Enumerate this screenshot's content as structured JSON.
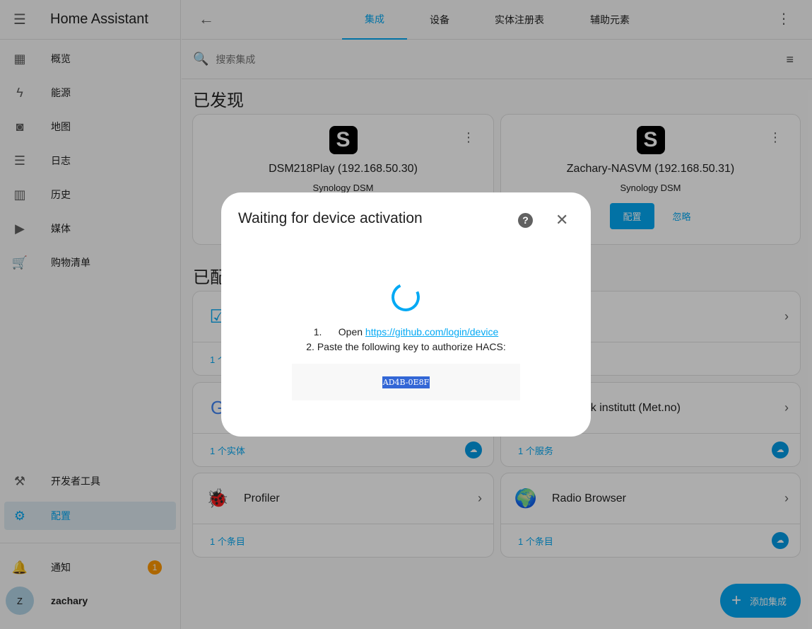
{
  "sidebar": {
    "title": "Home Assistant",
    "items": [
      {
        "label": "概览"
      },
      {
        "label": "能源"
      },
      {
        "label": "地图"
      },
      {
        "label": "日志"
      },
      {
        "label": "历史"
      },
      {
        "label": "媒体"
      },
      {
        "label": "购物清单"
      },
      {
        "label": "开发者工具"
      },
      {
        "label": "配置"
      }
    ],
    "notifications": {
      "label": "通知",
      "count": "1"
    },
    "user": {
      "initial": "Z",
      "name": "zachary"
    }
  },
  "header": {
    "tabs": [
      "集成",
      "设备",
      "实体注册表",
      "辅助元素"
    ]
  },
  "search": {
    "placeholder": "搜索集成"
  },
  "discovered": {
    "heading": "已发现",
    "cards": [
      {
        "name": "DSM218Play (192.168.50.30)",
        "type": "Synology DSM"
      },
      {
        "name": "Zachary-NASVM (192.168.50.31)",
        "type": "Synology DSM",
        "configure": "配置",
        "ignore": "忽略"
      }
    ]
  },
  "configured": {
    "heading": "已配",
    "cards": [
      {
        "name": "",
        "footer": "1 个"
      },
      {
        "name": "",
        "footer": ""
      },
      {
        "name": "",
        "footer": "1 个实体"
      },
      {
        "name": "ologisk institutt (Met.no)",
        "footer": "1 个服务"
      },
      {
        "name": "Profiler",
        "footer": "1 个条目"
      },
      {
        "name": "Radio Browser",
        "footer": "1 个条目"
      }
    ]
  },
  "fab": {
    "label": "添加集成"
  },
  "dialog": {
    "title": "Waiting for device activation",
    "step1_prefix": "1.      Open ",
    "step1_link": "https://github.com/login/device",
    "step2": "2. Paste the following key to authorize HACS:",
    "key": "AD4B-0E8F"
  }
}
